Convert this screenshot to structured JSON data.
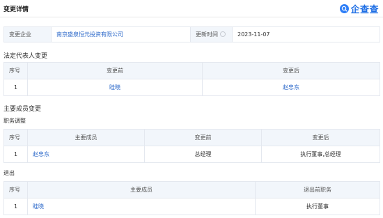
{
  "header": {
    "title": "变更详情",
    "logo_text": "企查查",
    "brand_color": "#2d7ef7"
  },
  "summary": {
    "company_label": "变更企业",
    "company_name": "南京盛泉恒元投资有限公司",
    "update_label": "更新时间",
    "update_date": "2023-11-07"
  },
  "legal_rep_change": {
    "title": "法定代表人变更",
    "columns": [
      "序号",
      "变更前",
      "变更后"
    ],
    "rows": [
      {
        "no": "1",
        "before": "眭晓",
        "after": "赵忠东"
      }
    ]
  },
  "main_members_change": {
    "title": "主要成员变更",
    "position_adjust": {
      "title": "职务调整",
      "columns": [
        "序号",
        "主要成员",
        "变更前",
        "变更后"
      ],
      "rows": [
        {
          "no": "1",
          "member": "赵忠东",
          "before": "总经理",
          "after": "执行董事,总经理"
        }
      ]
    },
    "exit": {
      "title": "退出",
      "columns": [
        "序号",
        "主要成员",
        "退出前职务"
      ],
      "rows": [
        {
          "no": "1",
          "member": "眭晓",
          "position": "执行董事"
        }
      ]
    }
  }
}
